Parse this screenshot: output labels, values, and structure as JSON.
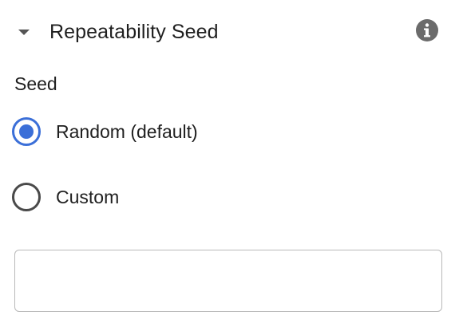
{
  "section": {
    "title": "Repeatability Seed",
    "expanded": true,
    "toggle_icon": "caret-down-icon",
    "info_icon": "info-icon"
  },
  "seed": {
    "label": "Seed",
    "options": [
      {
        "label": "Random (default)",
        "selected": true
      },
      {
        "label": "Custom",
        "selected": false
      }
    ],
    "custom_value": "",
    "placeholder": ""
  },
  "colors": {
    "accent": "#3b6fd8",
    "radio_border_unselected": "#4a4a4a",
    "icon_gray": "#6b6b6b",
    "input_border": "#b9b9b9",
    "text": "#1f1f1f"
  }
}
